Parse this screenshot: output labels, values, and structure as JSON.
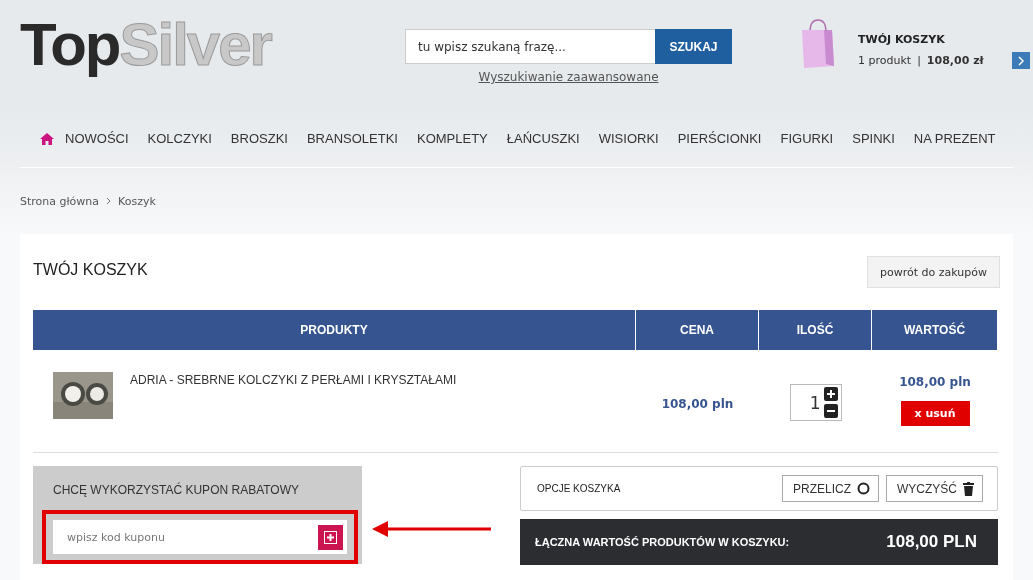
{
  "logo": {
    "dark": "Top",
    "light": "Silver"
  },
  "search": {
    "placeholder": "tu wpisz szukaną frazę...",
    "button": "SZUKAJ",
    "advanced_link": "Wyszukiwanie zaawansowane"
  },
  "cart": {
    "title": "TWÓJ KOSZYK",
    "count": "1 produkt",
    "separator": "|",
    "total": "108,00 zł"
  },
  "nav": [
    "NOWOŚCI",
    "KOLCZYKI",
    "BROSZKI",
    "BRANSOLETKI",
    "KOMPLETY",
    "ŁAŃCUSZKI",
    "WISIORKI",
    "PIERŚCIONKI",
    "FIGURKI",
    "SPINKI",
    "NA PREZENT"
  ],
  "breadcrumb": [
    "Strona główna",
    "Koszyk"
  ],
  "page_title": "TWÓJ KOSZYK",
  "back_button": "powrót do zakupów",
  "table": {
    "columns": [
      "PRODUKTY",
      "CENA",
      "ILOŚĆ",
      "WARTOŚĆ"
    ],
    "rows": [
      {
        "name": "ADRIA - SREBRNE KOLCZYKI Z PERŁAMI I KRYSZTAŁAMI",
        "price": "108,00 pln",
        "quantity": "1",
        "value": "108,00 pln",
        "remove": "x usuń"
      }
    ]
  },
  "coupon": {
    "title": "CHCĘ WYKORZYSTAĆ KUPON RABATOWY",
    "placeholder": "wpisz kod kuponu"
  },
  "options": {
    "title": "OPCJE KOSZYKA",
    "buttons": [
      "PRZELICZ",
      "WYCZYŚĆ"
    ]
  },
  "summary": {
    "label": "ŁĄCZNA WARTOŚĆ PRODUKTÓW W KOSZYKU:",
    "total": "108,00 PLN"
  }
}
